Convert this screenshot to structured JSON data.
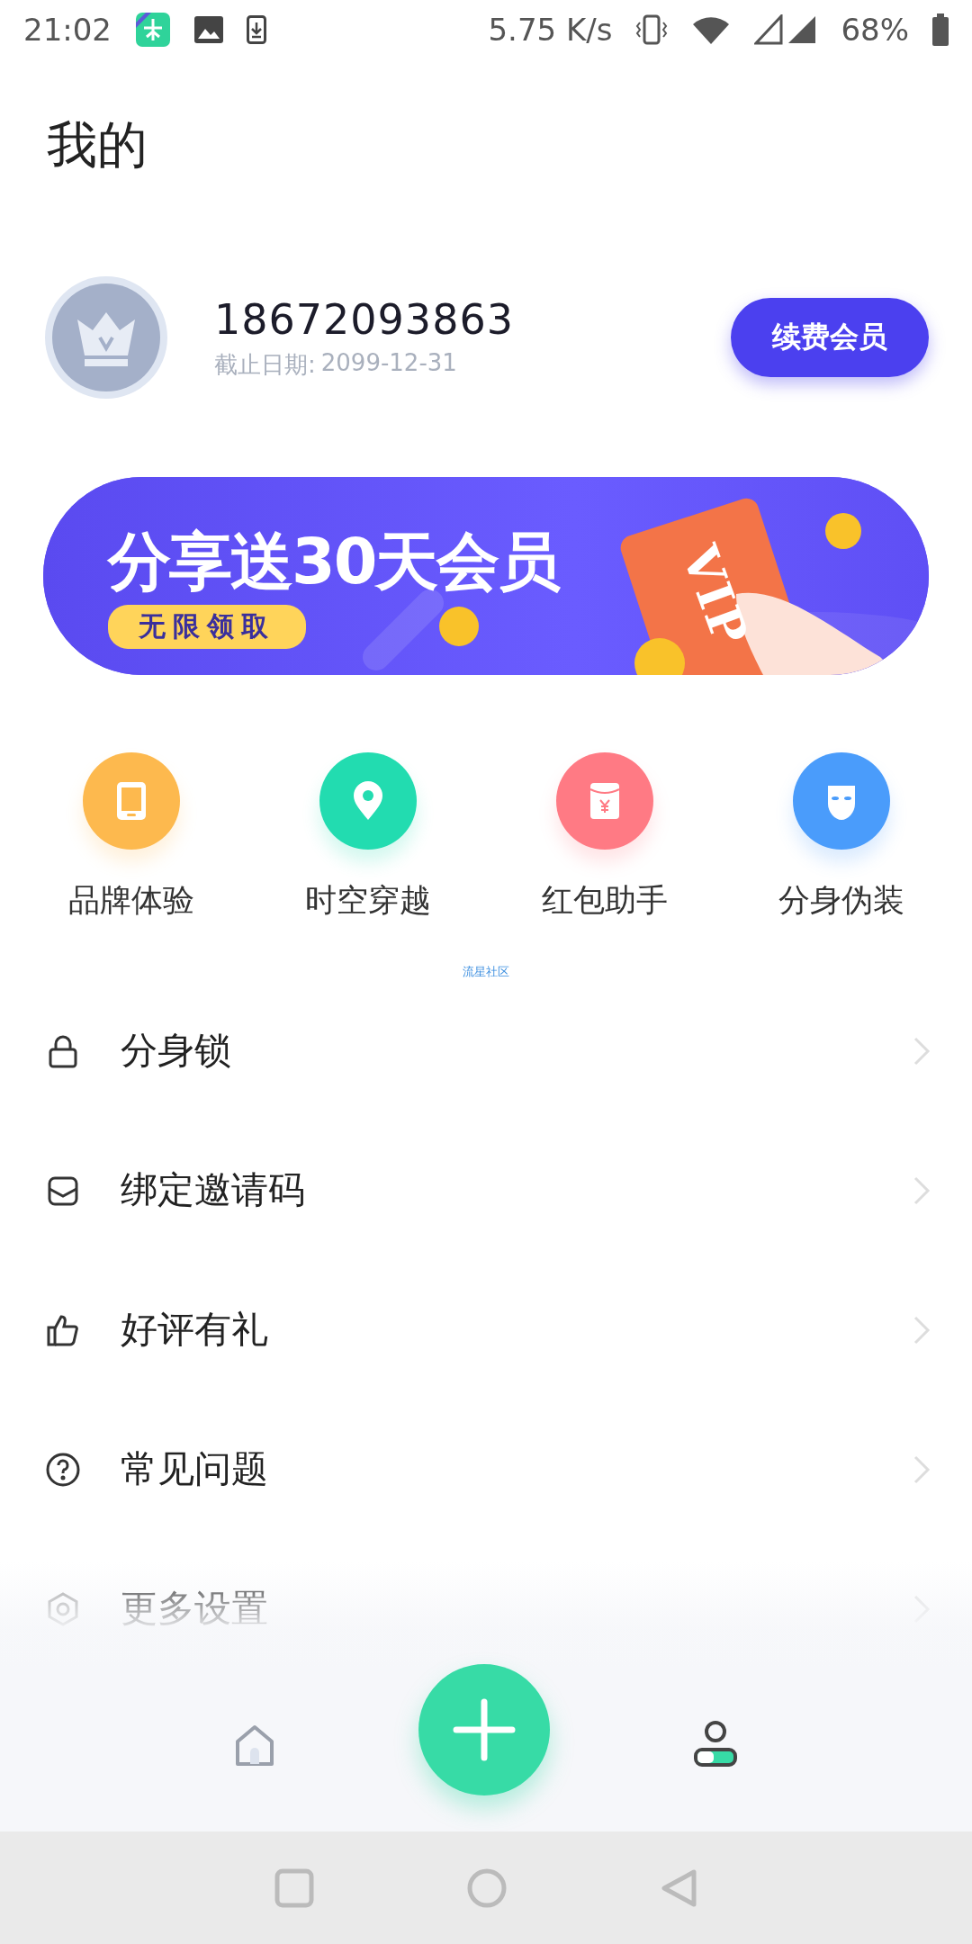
{
  "status_bar": {
    "time": "21:02",
    "speed": "5.75 K/s",
    "battery": "68%"
  },
  "header": {
    "title": "我的"
  },
  "profile": {
    "phone": "18672093863",
    "expiry_label": "截止日期:",
    "expiry_date": "2099-12-31",
    "renew_button": "续费会员"
  },
  "banner": {
    "title": "分享送30天会员",
    "tag": "无限领取",
    "card_text": "VIP"
  },
  "quick_actions": [
    {
      "label": "品牌体验",
      "kind": "phone",
      "color": "#fdb94e"
    },
    {
      "label": "时空穿越",
      "kind": "pin",
      "color": "#22dcb0"
    },
    {
      "label": "红包助手",
      "kind": "packet",
      "color": "#ff7a84"
    },
    {
      "label": "分身伪装",
      "kind": "mask",
      "color": "#4a9cfb"
    }
  ],
  "community_link": "流星社区",
  "menu": [
    {
      "label": "分身锁",
      "kind": "lock"
    },
    {
      "label": "绑定邀请码",
      "kind": "mail"
    },
    {
      "label": "好评有礼",
      "kind": "thumb"
    },
    {
      "label": "常见问题",
      "kind": "question"
    },
    {
      "label": "更多设置",
      "kind": "settings"
    }
  ],
  "bottom_nav": [
    {
      "kind": "home",
      "selected": false
    },
    {
      "kind": "add",
      "selected": false
    },
    {
      "kind": "profile",
      "selected": true
    }
  ]
}
